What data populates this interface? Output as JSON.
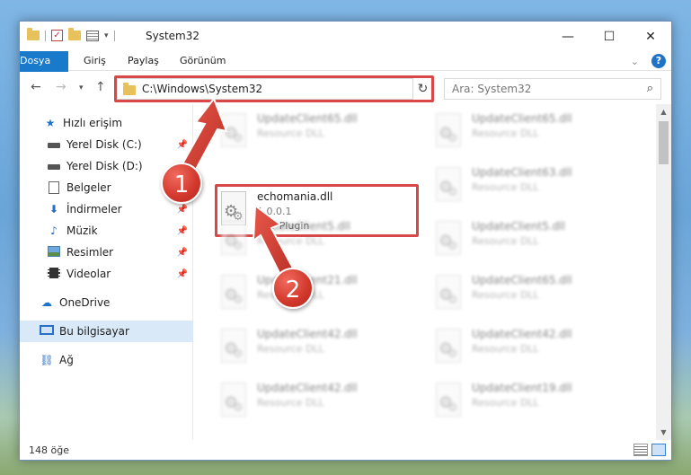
{
  "window": {
    "title": "System32",
    "controls": {
      "minimize": "—",
      "maximize": "☐",
      "close": "✕"
    }
  },
  "ribbon": {
    "tabs": [
      "Dosya",
      "Giriş",
      "Paylaş",
      "Görünüm"
    ],
    "expand": "⌄",
    "help": "?"
  },
  "address": {
    "path": "C:\\Windows\\System32",
    "search_placeholder": "Ara: System32"
  },
  "sidebar": {
    "items": [
      {
        "label": "Hızlı erişim",
        "icon": "star-icon",
        "pinned": false
      },
      {
        "label": "Yerel Disk (C:)",
        "icon": "disk-icon",
        "pinned": true
      },
      {
        "label": "Yerel Disk (D:)",
        "icon": "disk-icon",
        "pinned": false
      },
      {
        "label": "Belgeler",
        "icon": "document-icon",
        "pinned": false
      },
      {
        "label": "İndirmeler",
        "icon": "download-icon",
        "pinned": true
      },
      {
        "label": "Müzik",
        "icon": "music-icon",
        "pinned": true
      },
      {
        "label": "Resimler",
        "icon": "pictures-icon",
        "pinned": true
      },
      {
        "label": "Videolar",
        "icon": "video-icon",
        "pinned": true
      },
      {
        "label": "OneDrive",
        "icon": "cloud-icon",
        "pinned": false
      },
      {
        "label": "Bu bilgisayar",
        "icon": "computer-icon",
        "pinned": false
      },
      {
        "label": "Ağ",
        "icon": "network-icon",
        "pinned": false
      }
    ]
  },
  "files": {
    "highlighted": {
      "name": "echomania.dll",
      "version": "1.0.0.1",
      "type": "VST Plugin"
    },
    "left": [
      {
        "name": "UpdateClient65.dll",
        "type": "Resource DLL"
      },
      {
        "name": "UpdateClient5.dll",
        "type": "Resource DLL"
      },
      {
        "name": "UpdateClient21.dll",
        "type": "Resource DLL"
      },
      {
        "name": "UpdateClient42.dll",
        "type": "Resource DLL"
      },
      {
        "name": "UpdateClient42.dll",
        "type": "Resource DLL"
      }
    ],
    "right": [
      {
        "name": "UpdateClient65.dll",
        "type": "Resource DLL"
      },
      {
        "name": "UpdateClient63.dll",
        "type": "Resource DLL"
      },
      {
        "name": "UpdateClient5.dll",
        "type": "Resource DLL"
      },
      {
        "name": "UpdateClient65.dll",
        "type": "Resource DLL"
      },
      {
        "name": "UpdateClient42.dll",
        "type": "Resource DLL"
      },
      {
        "name": "UpdateClient19.dll",
        "type": "Resource DLL"
      }
    ]
  },
  "status": {
    "count": "148 öğe"
  },
  "callouts": {
    "one": "1",
    "two": "2"
  },
  "colors": {
    "accent": "#1979ca",
    "highlight": "#d94848",
    "callout": "#d2372b"
  }
}
